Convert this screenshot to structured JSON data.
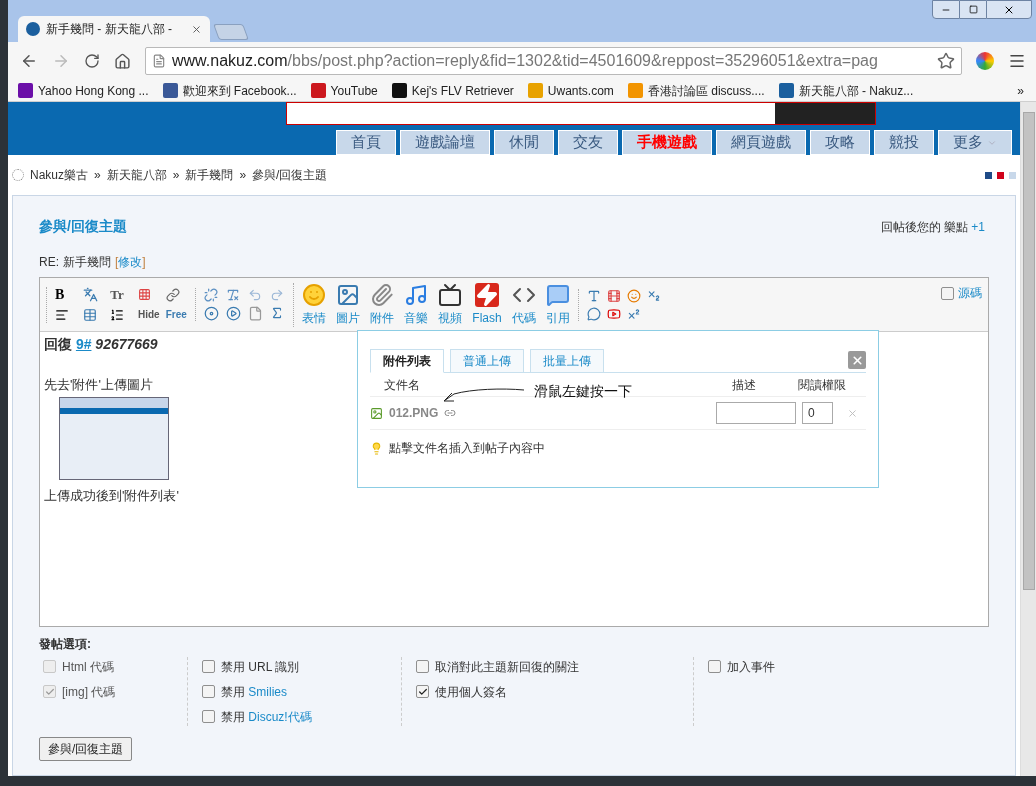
{
  "browser": {
    "tabs": [
      {
        "title": "新手幾問 - 新天龍八部 -",
        "selected": true
      }
    ],
    "address_host": "www.nakuz.com",
    "address_path": "/bbs/post.php?action=reply&fid=1302&tid=4501609&reppost=35296051&extra=pag",
    "bookmarks": [
      {
        "label": "Yahoo Hong Kong ...",
        "color": "#6b0fa8"
      },
      {
        "label": "歡迎來到 Facebook...",
        "color": "#3b5998"
      },
      {
        "label": "YouTube",
        "color": "#cc181e"
      },
      {
        "label": "Kej's FLV Retriever",
        "color": "#111111"
      },
      {
        "label": "Uwants.com",
        "color": "#e8a200"
      },
      {
        "label": "香港討論區 discuss....",
        "color": "#f29400"
      },
      {
        "label": "新天龍八部 - Nakuz...",
        "color": "#1b5f9e"
      }
    ],
    "bookmarks_more": "»"
  },
  "nav": [
    {
      "label": "首頁",
      "hot": false
    },
    {
      "label": "遊戲論壇",
      "hot": false
    },
    {
      "label": "休閒",
      "hot": false
    },
    {
      "label": "交友",
      "hot": false
    },
    {
      "label": "手機遊戲",
      "hot": true
    },
    {
      "label": "網頁遊戲",
      "hot": false
    },
    {
      "label": "攻略",
      "hot": false
    },
    {
      "label": "競投",
      "hot": false
    },
    {
      "label": "更多",
      "hot": false
    }
  ],
  "breadcrumb": {
    "items": [
      "Nakuz樂古",
      "新天龍八部",
      "新手幾問",
      "參與/回復主題"
    ],
    "separator": "»"
  },
  "reply": {
    "heading": "參與/回復主題",
    "points_label": "回帖後您的 樂點",
    "points_value": "+1",
    "subject_prefix": "RE:",
    "subject": "新手幾問",
    "edit_open": "[",
    "edit_link": "修改",
    "edit_close": "]"
  },
  "toolbar": {
    "glyphs": [
      "B",
      "Tr",
      "Hide",
      "Free"
    ],
    "buttons": [
      {
        "label": "表情",
        "kind": "smile"
      },
      {
        "label": "圖片",
        "kind": "image"
      },
      {
        "label": "附件",
        "kind": "attach"
      },
      {
        "label": "音樂",
        "kind": "music"
      },
      {
        "label": "視頻",
        "kind": "video"
      },
      {
        "label": "Flash",
        "kind": "flash"
      },
      {
        "label": "代碼",
        "kind": "code"
      },
      {
        "label": "引用",
        "kind": "quote"
      }
    ],
    "source": {
      "label": "源碼",
      "checked": false
    }
  },
  "editor": {
    "quote_prefix": "回復",
    "quote_link": "9#",
    "quote_user": "92677669",
    "line_1": "先去'附件'上傳圖片",
    "line_2": "上傳成功後到'附件列表'"
  },
  "popup": {
    "tabs": [
      {
        "label": "附件列表",
        "selected": true
      },
      {
        "label": "普通上傳",
        "selected": false
      },
      {
        "label": "批量上傳",
        "selected": false
      }
    ],
    "columns": [
      "文件名",
      "描述",
      "閱讀權限"
    ],
    "files": [
      {
        "name": "012.PNG",
        "permission": "0"
      }
    ],
    "annotation": "滑鼠左鍵按一下",
    "tip": "點擊文件名插入到帖子內容中"
  },
  "options": {
    "title": "發帖選項:",
    "columns": [
      [
        {
          "label": "Html 代碼",
          "checked": false,
          "disabled": true
        },
        {
          "label": "[img] 代碼",
          "checked": true,
          "disabled": true
        }
      ],
      [
        {
          "label": "禁用 URL 識別",
          "checked": false,
          "disabled": false
        },
        {
          "label": "禁用",
          "link": "Smilies",
          "checked": false,
          "disabled": false
        },
        {
          "label": "禁用",
          "link": "Discuz!代碼",
          "checked": false,
          "disabled": false
        }
      ],
      [
        {
          "label": "取消對此主題新回復的關注",
          "checked": false,
          "disabled": false
        },
        {
          "label": "使用個人簽名",
          "checked": true,
          "disabled": false
        }
      ],
      [
        {
          "label": "加入事件",
          "checked": false,
          "disabled": false
        }
      ]
    ]
  },
  "submit": "參與/回復主題"
}
